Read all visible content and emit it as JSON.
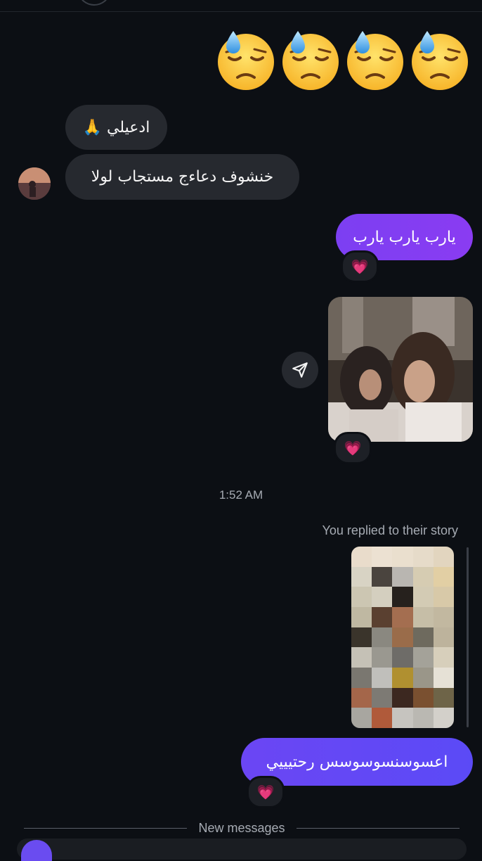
{
  "conversation": {
    "big_emojis": [
      "😓",
      "😓",
      "😓",
      "😓"
    ],
    "incoming": [
      {
        "text": "ادعيلي 🙏"
      },
      {
        "text": "خنشوف دعاءج مستجاب لولا"
      }
    ],
    "outgoing_1": {
      "text": "يارب يارب يارب",
      "reaction": "💗"
    },
    "shared_photo": {
      "reaction": "💗",
      "share_icon": "send-icon"
    },
    "timestamp": "1:52 AM",
    "story_reply_label": "You replied to their story",
    "outgoing_2": {
      "text": "اعسوسنسوسوسس رحتيييي",
      "reaction": "💗"
    },
    "new_messages_divider": "New messages"
  },
  "colors": {
    "background": "#0c0f14",
    "incoming_bubble": "#26292f",
    "outgoing_gradient_start": "#8a3cf2",
    "outgoing_gradient_end": "#5b4af6",
    "meta_text": "#a6abb3"
  }
}
